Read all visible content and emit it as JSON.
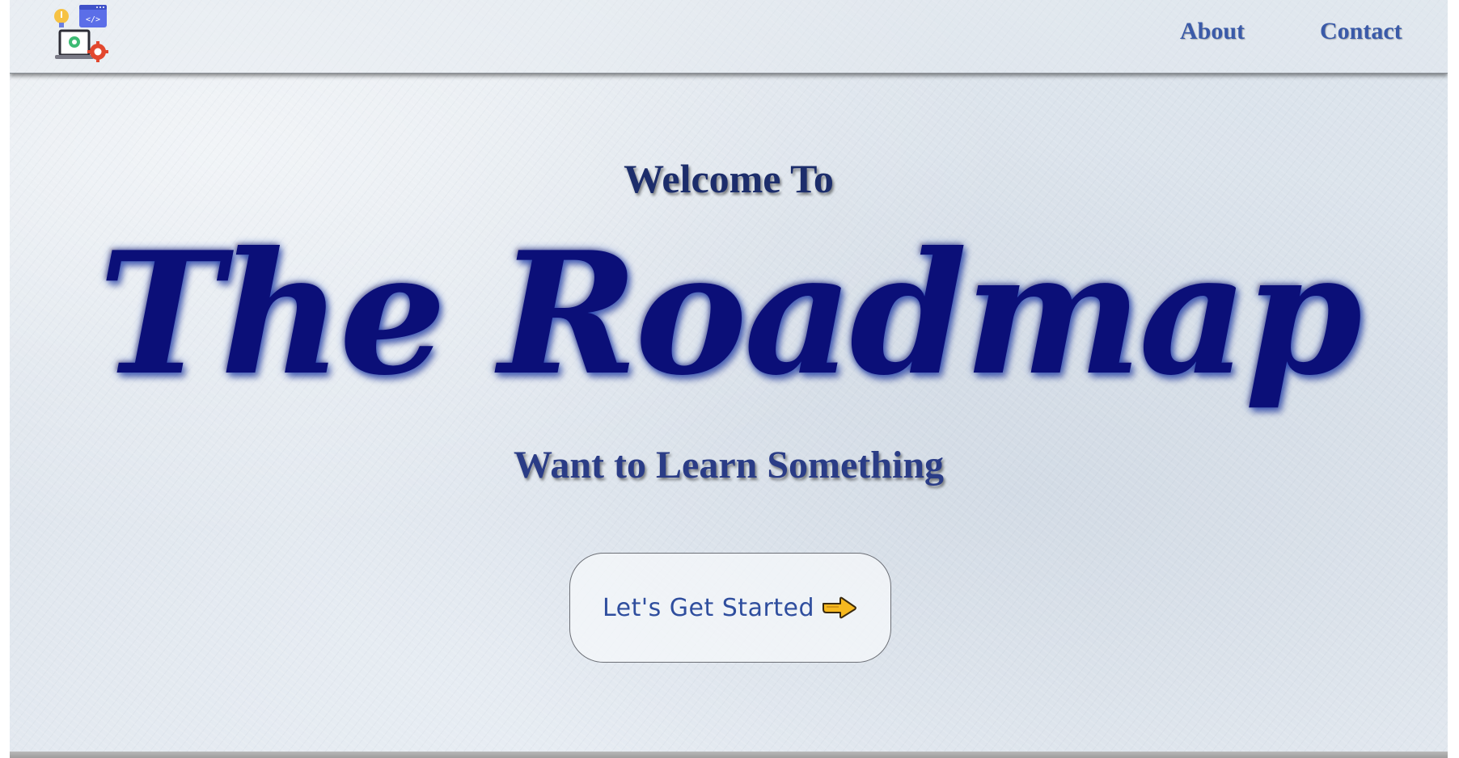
{
  "nav": {
    "about": "About",
    "contact": "Contact"
  },
  "hero": {
    "welcome": "Welcome To",
    "title": "The Roadmap",
    "tagline": "Want to Learn Something"
  },
  "cta": {
    "label": "Let's Get Started",
    "icon": "pointing-hand-right-icon"
  },
  "logo": {
    "icon": "developer-laptop-gear-icon",
    "code_glyph": "</>"
  },
  "colors": {
    "nav_link": "#3a5aa8",
    "title": "#0b0f78",
    "welcome": "#1c2d6b",
    "cta_text": "#2f4e9e",
    "background": "#e0e6ed"
  }
}
